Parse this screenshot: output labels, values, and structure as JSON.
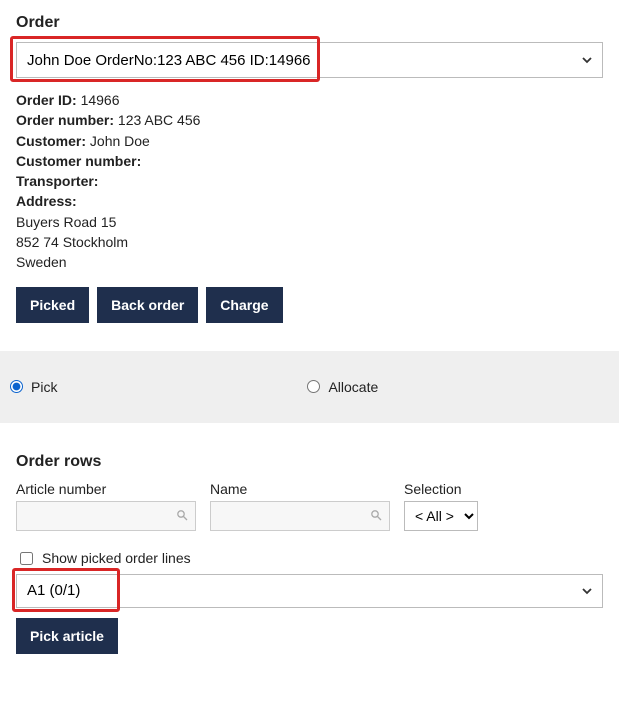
{
  "order": {
    "heading": "Order",
    "selected_text": "John Doe OrderNo:123 ABC 456 ID:14966",
    "details": {
      "order_id_label": "Order ID:",
      "order_id_value": "14966",
      "order_number_label": "Order number:",
      "order_number_value": "123 ABC 456",
      "customer_label": "Customer:",
      "customer_value": "John Doe",
      "customer_number_label": "Customer number:",
      "customer_number_value": "",
      "transporter_label": "Transporter:",
      "transporter_value": "",
      "address_label": "Address:",
      "address_line1": "Buyers Road 15",
      "address_line2": "852 74 Stockholm",
      "address_line3": "Sweden"
    },
    "buttons": {
      "picked": "Picked",
      "back_order": "Back order",
      "charge": "Charge"
    }
  },
  "mode": {
    "pick_label": "Pick",
    "allocate_label": "Allocate"
  },
  "order_rows": {
    "heading": "Order rows",
    "filters": {
      "article_number_label": "Article number",
      "name_label": "Name",
      "selection_label": "Selection",
      "selection_value": "< All >"
    },
    "show_picked_label": "Show picked order lines",
    "row_select_value": "A1 (0/1)",
    "pick_article_button": "Pick article"
  }
}
